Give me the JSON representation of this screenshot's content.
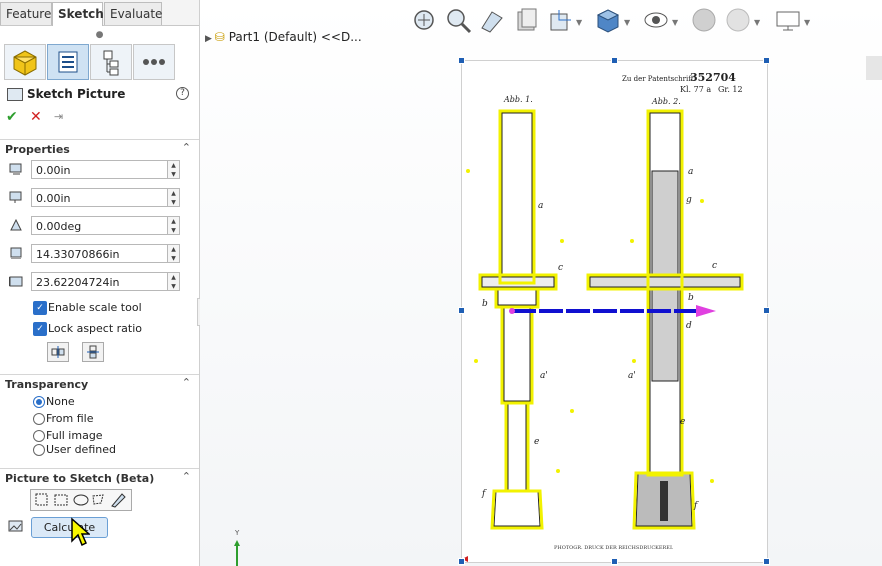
{
  "tabs": [
    "Features",
    "Sketch",
    "Evaluate"
  ],
  "property_manager": {
    "title": "Sketch Picture",
    "help": "?"
  },
  "properties": {
    "section": "Properties",
    "x": "0.00in",
    "y": "0.00in",
    "angle": "0.00deg",
    "width": "14.33070866in",
    "height": "23.62204724in",
    "enable_scale_tool": "Enable scale tool",
    "lock_aspect_ratio": "Lock aspect ratio"
  },
  "transparency": {
    "section": "Transparency",
    "options": [
      "None",
      "From file",
      "Full image",
      "User defined"
    ],
    "selected": "None"
  },
  "picture_to_sketch": {
    "section": "Picture to Sketch (Beta)",
    "calculate": "Calculate"
  },
  "tree": {
    "label": "Part1 (Default) <<D..."
  },
  "patent": {
    "header": "Zu der Patentschrift",
    "number": "352704",
    "class": "Kl. 77 a",
    "group": "Gr. 12",
    "fig1": "Abb. 1.",
    "fig2": "Abb. 2.",
    "footer": "PHOTOGR. DRUCK DER REICHSDRUCKEREI.",
    "labels1": [
      "a",
      "c",
      "b",
      "a'",
      "e",
      "f"
    ],
    "labels2": [
      "a",
      "g",
      "c",
      "b",
      "d",
      "a'",
      "e",
      "f"
    ]
  },
  "triad": {
    "y": "Y"
  },
  "colors": {
    "accent": "#2a6fc9",
    "trace": "#f2f200",
    "arrow_blue": "#1010d0",
    "arrow_magenta": "#e040e0"
  }
}
